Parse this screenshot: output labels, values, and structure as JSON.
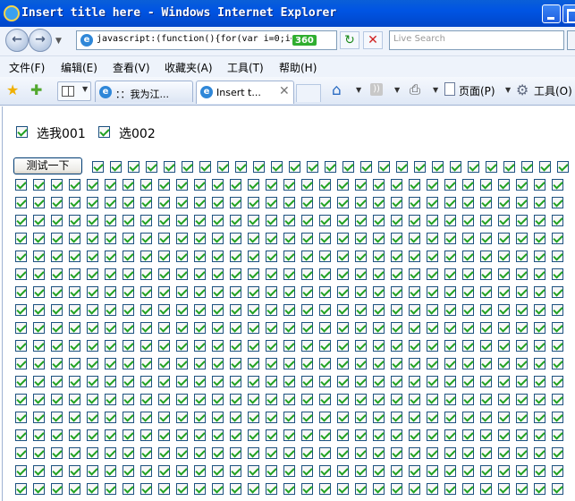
{
  "window": {
    "title": "Insert title here - Windows Internet Explorer"
  },
  "nav": {
    "address": "javascript:(function(){for(var i=0;i<",
    "address_badge": "360",
    "search_placeholder": "Live Search"
  },
  "menu": {
    "items": [
      "文件(F)",
      "编辑(E)",
      "查看(V)",
      "收藏夹(A)",
      "工具(T)",
      "帮助(H)"
    ]
  },
  "tabs": [
    {
      "label": "：：我为江..."
    },
    {
      "label": "Insert t..."
    }
  ],
  "toolbar": {
    "page_label": "页面(P)",
    "tools_label": "工具(O)"
  },
  "icons": [
    "back-icon",
    "forward-icon",
    "refresh-icon",
    "stop-icon",
    "favorites-star-icon",
    "add-favorites-icon",
    "quick-tabs-icon",
    "home-icon",
    "feeds-icon",
    "print-icon",
    "page-icon",
    "tools-gear-icon"
  ],
  "page": {
    "checkbox_1_label": "选我001",
    "checkbox_1_checked": true,
    "checkbox_2_label": "选002",
    "checkbox_2_checked": true,
    "test_button_label": "测试一下",
    "grid_all_checked": true
  },
  "colors": {
    "titlebar": "#0054e3",
    "check": "#21a121"
  }
}
